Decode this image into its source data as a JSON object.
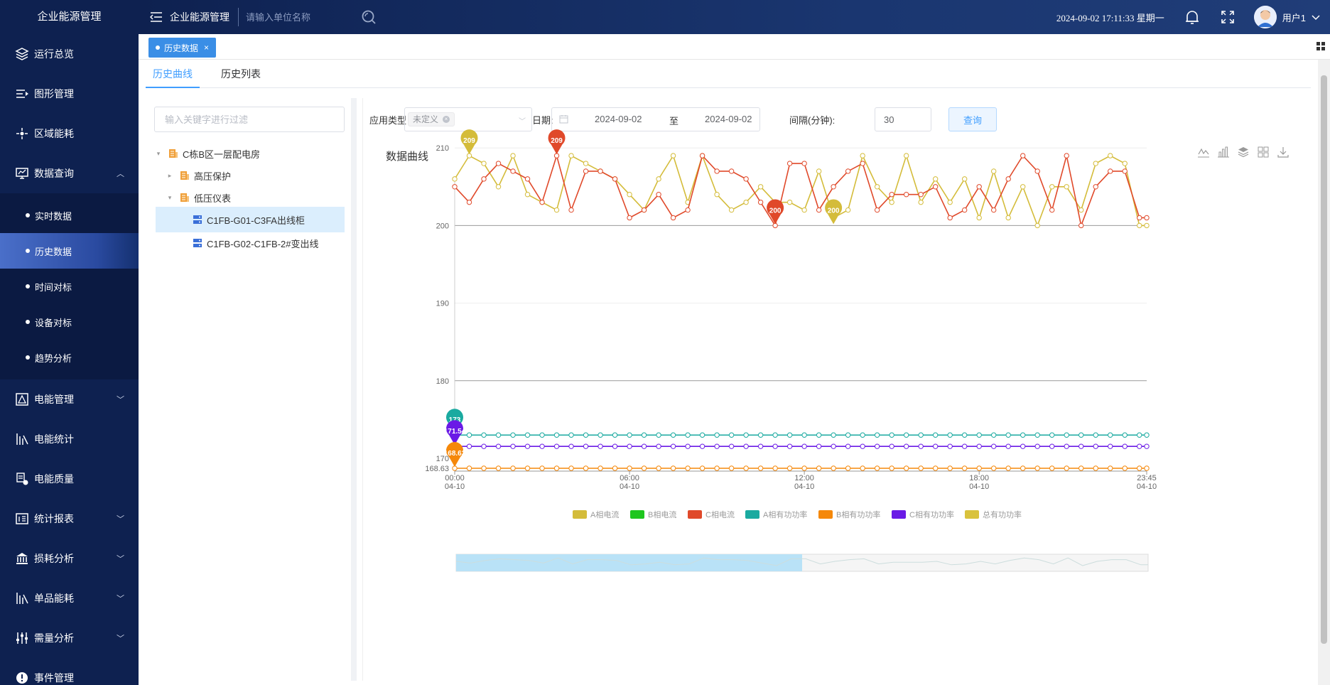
{
  "app": {
    "brand": "企业能源管理",
    "title": "企业能源管理",
    "unit_search_placeholder": "请输入单位名称",
    "datetime": "2024-09-02 17:11:33 星期一",
    "username": "用户1"
  },
  "sidebar": {
    "items": [
      {
        "label": "运行总览",
        "icon": "layers-icon"
      },
      {
        "label": "图形管理",
        "icon": "graph-manage-icon"
      },
      {
        "label": "区域能耗",
        "icon": "region-icon"
      },
      {
        "label": "数据查询",
        "icon": "monitor-icon"
      },
      {
        "label": "电能管理",
        "icon": "power-manage-icon"
      },
      {
        "label": "电能统计",
        "icon": "stats-icon"
      },
      {
        "label": "电能质量",
        "icon": "quality-icon"
      },
      {
        "label": "统计报表",
        "icon": "report-icon"
      },
      {
        "label": "损耗分析",
        "icon": "bank-icon"
      },
      {
        "label": "单品能耗",
        "icon": "product-icon"
      },
      {
        "label": "需量分析",
        "icon": "sliders-icon"
      },
      {
        "label": "事件管理",
        "icon": "alert-icon"
      }
    ],
    "sub_items": [
      "实时数据",
      "历史数据",
      "时间对标",
      "设备对标",
      "趋势分析"
    ]
  },
  "tagbar": {
    "tag_label": "历史数据",
    "close": "×"
  },
  "tabs": [
    "历史曲线",
    "历史列表"
  ],
  "tree": {
    "filter_placeholder": "输入关键字进行过滤",
    "nodes": [
      "C栋B区一层配电房",
      "高压保护",
      "低压仪表",
      "C1FB-G01-C3FA出线柜",
      "C1FB-G02-C1FB-2#变出线"
    ]
  },
  "filters": {
    "app_type_label": "应用类型",
    "app_type_value": "未定义",
    "date_label": "日期:",
    "date_start": "2024-09-02",
    "date_to": "至",
    "date_end": "2024-09-02",
    "interval_label": "间隔(分钟):",
    "interval_value": "30",
    "query_button": "查询"
  },
  "chart_title": "数据曲线",
  "chart_data": {
    "type": "line",
    "ylim": [
      168.63,
      212
    ],
    "y_ticks": [
      "210",
      "200",
      "190",
      "180",
      "170",
      "168.63"
    ],
    "x_ticks": [
      {
        "time": "00:00",
        "date": "04-10"
      },
      {
        "time": "06:00",
        "date": "04-10"
      },
      {
        "time": "12:00",
        "date": "04-10"
      },
      {
        "time": "18:00",
        "date": "04-10"
      },
      {
        "time": "23:45",
        "date": "04-10"
      }
    ],
    "x_hours": [
      0,
      0.5,
      1,
      1.5,
      2,
      2.5,
      3,
      3.5,
      4,
      4.5,
      5,
      5.5,
      6,
      6.5,
      7,
      7.5,
      8,
      8.5,
      9,
      9.5,
      10,
      10.5,
      11,
      11.5,
      12,
      12.5,
      13,
      13.5,
      14,
      14.5,
      15,
      15.5,
      16,
      16.5,
      17,
      17.5,
      18,
      18.5,
      19,
      19.5,
      20,
      20.5,
      21,
      21.5,
      22,
      22.5,
      23,
      23.5,
      23.75
    ],
    "series": [
      {
        "name": "A相电流",
        "color": "#d4bc3a",
        "values": [
          206,
          209,
          208,
          205,
          209,
          204,
          203,
          202,
          209,
          208,
          207,
          206,
          204,
          202,
          206,
          209,
          203,
          209,
          204,
          202,
          203,
          205,
          203,
          203,
          202,
          207,
          201,
          202,
          209,
          205,
          203,
          209,
          203,
          206,
          203,
          206,
          201,
          207,
          201,
          205,
          200,
          205,
          205,
          202,
          208,
          209,
          208,
          200,
          200
        ]
      },
      {
        "name": "B相电流",
        "color": "#1ec61e",
        "values": []
      },
      {
        "name": "C相电流",
        "color": "#e0492a",
        "values": [
          205,
          203,
          206,
          208,
          207,
          206,
          203,
          209,
          202,
          207,
          207,
          206,
          201,
          202,
          204,
          201,
          202,
          209,
          207,
          207,
          206,
          203,
          200,
          208,
          208,
          202,
          205,
          207,
          208,
          202,
          204,
          204,
          204,
          205,
          201,
          202,
          205,
          202,
          206,
          209,
          207,
          202,
          209,
          200,
          205,
          207,
          207,
          201,
          201
        ]
      },
      {
        "name": "A相有功功率",
        "color": "#1aaaa0",
        "values": [
          173,
          173,
          173,
          173,
          173,
          173,
          173,
          173,
          173,
          173,
          173,
          173,
          173,
          173,
          173,
          173,
          173,
          173,
          173,
          173,
          173,
          173,
          173,
          173,
          173,
          173,
          173,
          173,
          173,
          173,
          173,
          173,
          173,
          173,
          173,
          173,
          173,
          173,
          173,
          173,
          173,
          173,
          173,
          173,
          173,
          173,
          173,
          173,
          173
        ]
      },
      {
        "name": "B相有功功率",
        "color": "#f5880a",
        "values": [
          168.63,
          168.63,
          168.63,
          168.63,
          168.63,
          168.63,
          168.63,
          168.63,
          168.63,
          168.63,
          168.63,
          168.63,
          168.63,
          168.63,
          168.63,
          168.63,
          168.63,
          168.63,
          168.63,
          168.63,
          168.63,
          168.63,
          168.63,
          168.63,
          168.63,
          168.63,
          168.63,
          168.63,
          168.63,
          168.63,
          168.63,
          168.63,
          168.63,
          168.63,
          168.63,
          168.63,
          168.63,
          168.63,
          168.63,
          168.63,
          168.63,
          168.63,
          168.63,
          168.63,
          168.63,
          168.63,
          168.63,
          168.63,
          168.63
        ]
      },
      {
        "name": "C相有功功率",
        "color": "#6a1ae6",
        "values": [
          171.54,
          171.54,
          171.54,
          171.54,
          171.54,
          171.54,
          171.54,
          171.54,
          171.54,
          171.54,
          171.54,
          171.54,
          171.54,
          171.54,
          171.54,
          171.54,
          171.54,
          171.54,
          171.54,
          171.54,
          171.54,
          171.54,
          171.54,
          171.54,
          171.54,
          171.54,
          171.54,
          171.54,
          171.54,
          171.54,
          171.54,
          171.54,
          171.54,
          171.54,
          171.54,
          171.54,
          171.54,
          171.54,
          171.54,
          171.54,
          171.54,
          171.54,
          171.54,
          171.54,
          171.54,
          171.54,
          171.54,
          171.54,
          171.54
        ]
      },
      {
        "name": "总有功功率",
        "color": "#d9c23c",
        "values": []
      }
    ],
    "markers": [
      {
        "series": "A相电流",
        "label": "209",
        "x_hour": 0.5,
        "y": 209,
        "color": "#d4bc3a"
      },
      {
        "series": "C相电流",
        "label": "209",
        "x_hour": 3.5,
        "y": 209,
        "color": "#e0492a"
      },
      {
        "series": "C相电流",
        "label": "200",
        "x_hour": 11,
        "y": 200,
        "color": "#e0492a"
      },
      {
        "series": "A相电流",
        "label": "200",
        "x_hour": 13,
        "y": 200,
        "color": "#d4bc3a"
      },
      {
        "series": "A相有功功率",
        "label": "173",
        "x_hour": 0,
        "y": 173,
        "color": "#1aaaa0"
      },
      {
        "series": "C相有功功率",
        "label": "171.54",
        "x_hour": 0,
        "y": 171.54,
        "color": "#6a1ae6"
      },
      {
        "series": "B相有功功率",
        "label": "168.63",
        "x_hour": 0,
        "y": 168.63,
        "color": "#f5880a"
      }
    ],
    "grid": true,
    "legend_position": "bottom-center",
    "data_zoom": {
      "start_fraction": 0,
      "end_fraction": 0.5
    }
  }
}
